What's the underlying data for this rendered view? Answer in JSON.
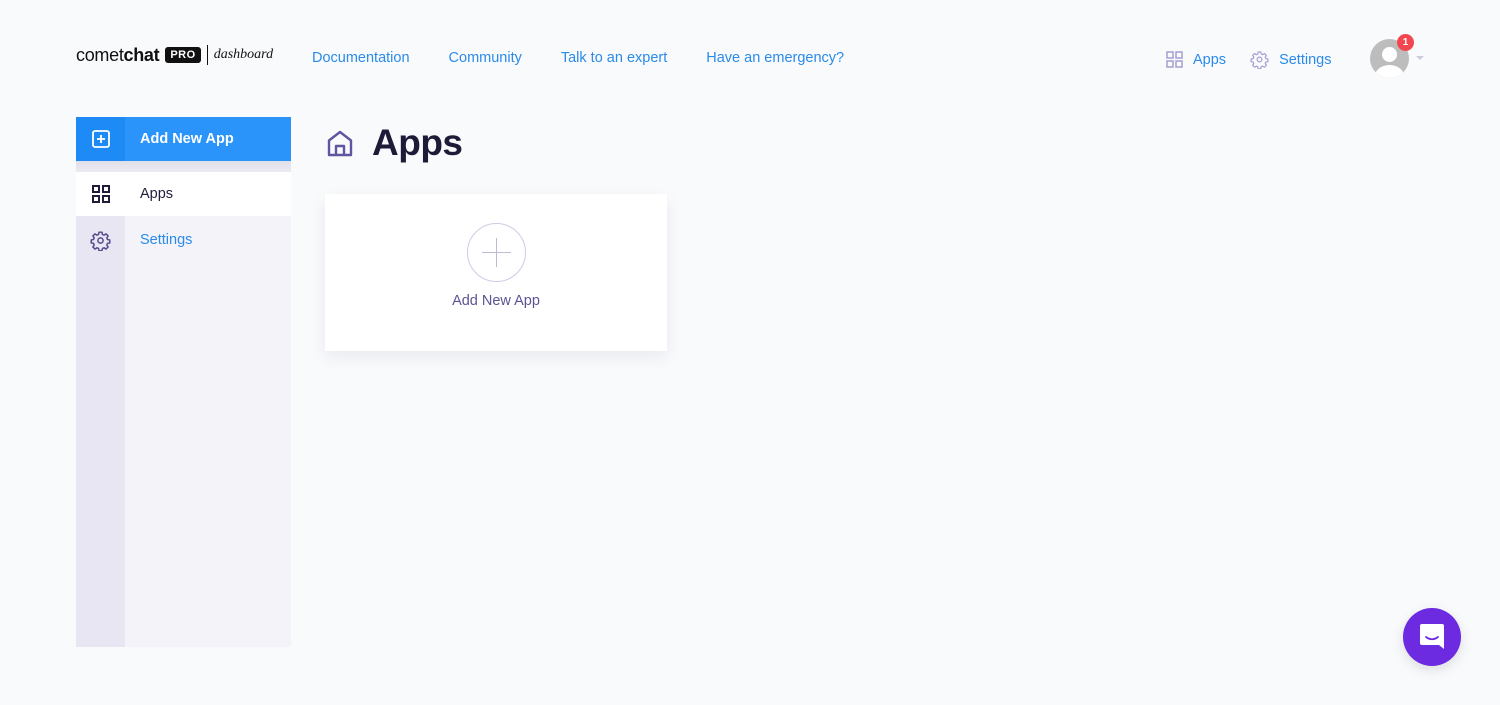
{
  "brand": {
    "name_light": "comet",
    "name_bold": "chat",
    "tier_badge": "PRO",
    "suffix": "dashboard"
  },
  "top_nav": {
    "links": [
      {
        "label": "Documentation"
      },
      {
        "label": "Community"
      },
      {
        "label": "Talk to an expert"
      },
      {
        "label": "Have an emergency?"
      }
    ],
    "right": {
      "apps_label": "Apps",
      "apps_icon": "grid-icon",
      "settings_label": "Settings",
      "settings_icon": "gear-icon",
      "notification_count": "1"
    }
  },
  "sidebar": {
    "add_button_label": "Add New App",
    "items": [
      {
        "label": "Apps",
        "icon": "grid-icon",
        "active": true
      },
      {
        "label": "Settings",
        "icon": "gear-icon",
        "active": false
      }
    ]
  },
  "main": {
    "title": "Apps",
    "title_icon": "home-icon",
    "add_card_label": "Add New App"
  },
  "colors": {
    "link": "#2a8bea",
    "primary_button": "#2a94fb",
    "icon_purple": "#6a5fa8",
    "launcher": "#6c2be0",
    "badge": "#f2474e"
  }
}
